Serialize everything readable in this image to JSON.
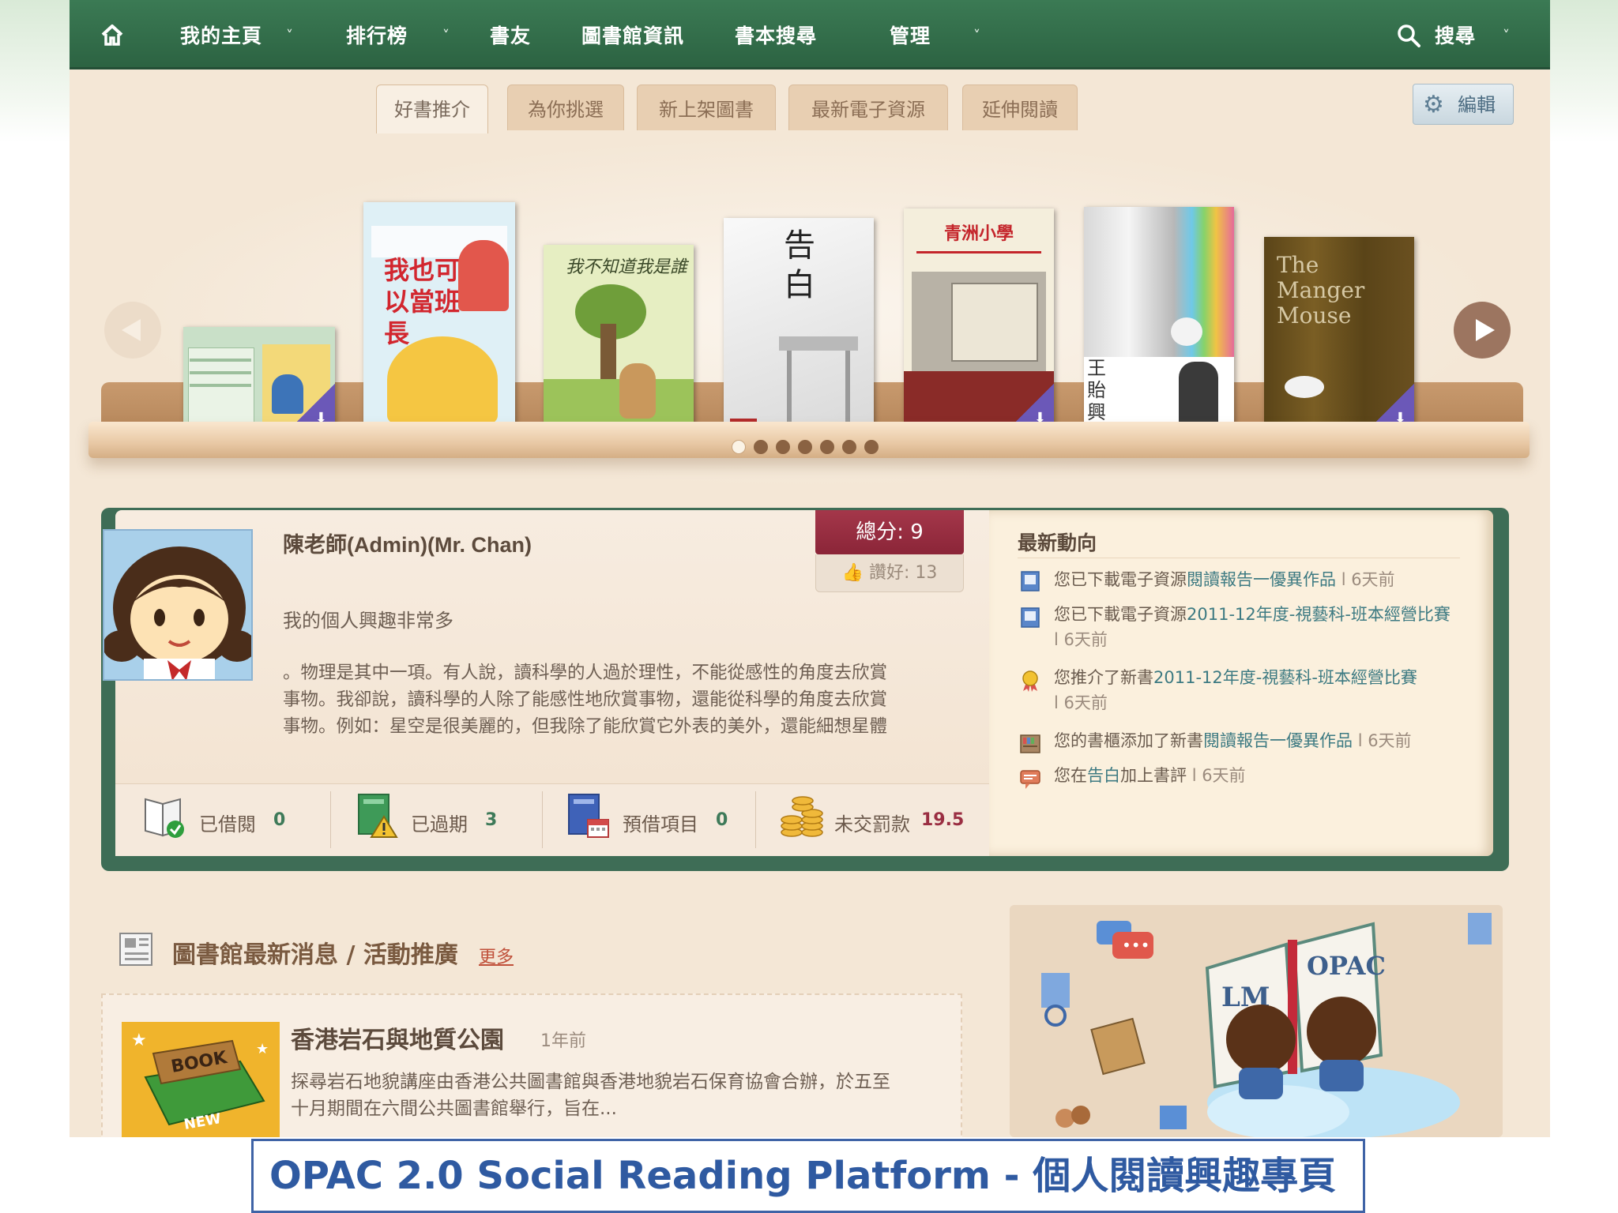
{
  "nav": {
    "home_icon": "home-icon",
    "items": [
      "我的主頁",
      "排行榜",
      "書友",
      "圖書館資訊",
      "書本搜尋",
      "管理"
    ],
    "search_label": "搜尋"
  },
  "tabs": [
    "好書推介",
    "為你挑選",
    "新上架圖書",
    "最新電子資源",
    "延伸閱讀"
  ],
  "edit_label": "編輯",
  "shelf": {
    "book_texts": {
      "b2": "我也可以當班長",
      "b3": "我不知道我是誰",
      "b4": "告白",
      "b5": "青洲小學",
      "b6": "王貽興",
      "b7": "The Manger Mouse"
    },
    "page_count": 7,
    "active_page": 1
  },
  "profile": {
    "name": "陳老師(Admin)(Mr. Chan)",
    "score_label": "總分: 9",
    "likes_label": "讚好: 13",
    "intro": "我的個人興趣非常多",
    "bio_lines": [
      "。物理是其中一項。有人說，讀科學的人過於理性，不能從感性的角度去欣賞",
      "事物。我卻說，讀科學的人除了能感性地欣賞事物，還能從科學的角度去欣賞",
      "事物。例如：星空是很美麗的，但我除了能欣賞它外表的美外，還能細想星體"
    ],
    "stats": [
      {
        "label": "已借閱",
        "value": "0"
      },
      {
        "label": "已過期",
        "value": "3"
      },
      {
        "label": "預借項目",
        "value": "0"
      },
      {
        "label": "未交罰款",
        "value": "19.5"
      }
    ]
  },
  "activity": {
    "title": "最新動向",
    "items": [
      {
        "prefix": "您已下載電子資源",
        "link": "閱讀報告一優異作品",
        "time": "l 6天前"
      },
      {
        "prefix": "您已下載電子資源",
        "link": "2011-12年度-視藝科-班本經營比賽",
        "time": "l 6天前"
      },
      {
        "prefix": "您推介了新書",
        "link": "2011-12年度-視藝科-班本經營比賽",
        "time": "l 6天前"
      },
      {
        "prefix": "您的書櫃添加了新書",
        "link": "閱讀報告一優異作品",
        "time": "l 6天前"
      },
      {
        "prefix": "您在",
        "link": "告白",
        "suffix": "加上書評",
        "time": "l 6天前"
      }
    ]
  },
  "news": {
    "title": "圖書館最新消息 / 活動推廣",
    "more": "更多",
    "item_title": "香港岩石與地質公園",
    "item_time": "1年前",
    "item_lines": [
      "探尋岩石地貌講座由香港公共圖書館與香港地貌岩石保育協會合辦，於五至",
      "十月期間在六間公共圖書館舉行，旨在..."
    ],
    "book_icon_text": "BOOK",
    "new_text": "NEW"
  },
  "promo": {
    "left_text": "LM",
    "right_text": "OPAC"
  },
  "caption": "OPAC 2.0 Social Reading Platform - 個人閱讀興趣專頁",
  "colors": {
    "nav_green": "#2f6a47",
    "panel_green": "#3e6d56",
    "page_bg": "#f4e7d6",
    "ribbon": "#9a2e42",
    "caption_blue": "#2f5aa1"
  }
}
